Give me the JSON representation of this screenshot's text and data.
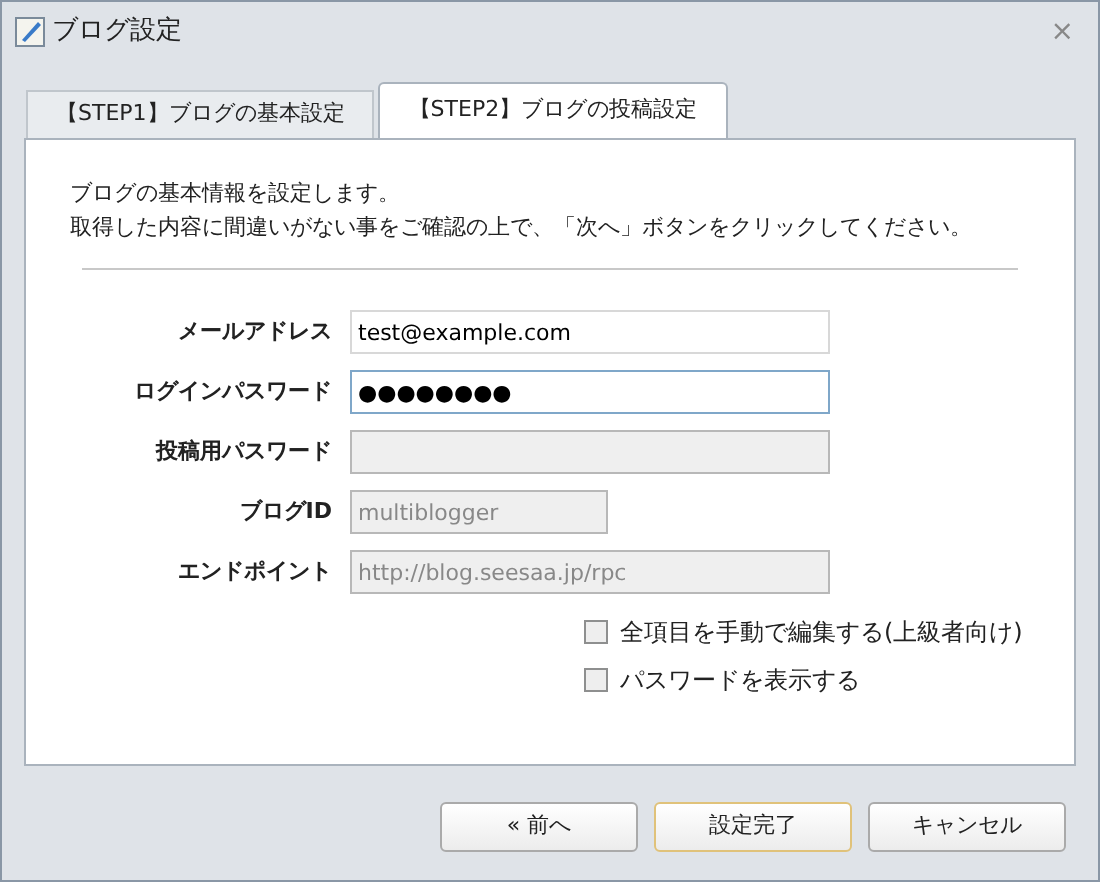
{
  "window": {
    "title": "ブログ設定",
    "close": "⨯"
  },
  "tabs": [
    {
      "label": "【STEP1】ブログの基本設定",
      "selected": false
    },
    {
      "label": "【STEP2】ブログの投稿設定",
      "selected": true
    }
  ],
  "intro": [
    "ブログの基本情報を設定します。",
    "取得した内容に間違いがない事をご確認の上で、「次へ」ボタンをクリックしてください。"
  ],
  "fields": [
    {
      "label": "メールアドレス",
      "value": "test@example.com",
      "kind": "wide",
      "disabled": false,
      "focused": false
    },
    {
      "label": "ログインパスワード",
      "value": "●●●●●●●●",
      "kind": "wide",
      "disabled": false,
      "focused": true
    },
    {
      "label": "投稿用パスワード",
      "kind": "wide",
      "disabled": true,
      "focused": false
    },
    {
      "label": "ブログID",
      "value": "multiblogger",
      "kind": "narrow",
      "disabled": true,
      "focused": false
    },
    {
      "label": "エンドポイント",
      "value": "http://blog.seesaa.jp/rpc",
      "kind": "wide",
      "disabled": true,
      "focused": false
    }
  ],
  "checkboxes": [
    {
      "label": "全項目を手動で編集する(上級者向け)",
      "checked": false
    },
    {
      "label": "パスワードを表示する",
      "checked": false
    }
  ],
  "buttons": [
    {
      "label": "« 前へ",
      "default": false
    },
    {
      "label": "設定完了",
      "default": true
    },
    {
      "label": "キャンセル",
      "default": false
    }
  ]
}
